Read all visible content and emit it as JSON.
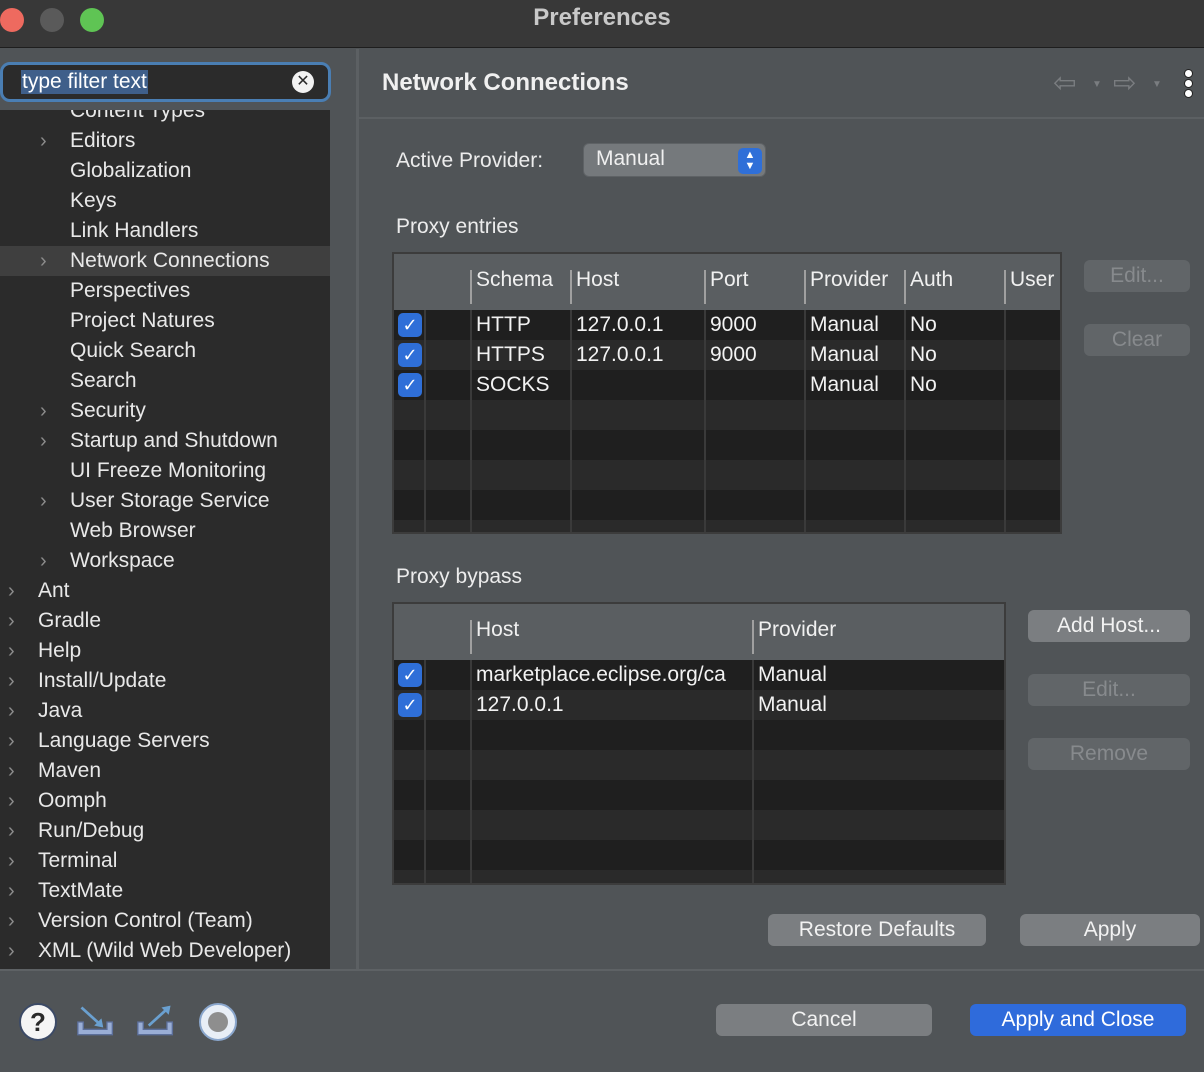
{
  "window": {
    "title": "Preferences"
  },
  "filter": {
    "value": "type filter text",
    "clear_icon": "clear-icon"
  },
  "tree": {
    "items": [
      {
        "label": "Content Types",
        "level": 1,
        "expandable": false,
        "selected": false
      },
      {
        "label": "Editors",
        "level": 1,
        "expandable": true,
        "selected": false
      },
      {
        "label": "Globalization",
        "level": 1,
        "expandable": false,
        "selected": false
      },
      {
        "label": "Keys",
        "level": 1,
        "expandable": false,
        "selected": false
      },
      {
        "label": "Link Handlers",
        "level": 1,
        "expandable": false,
        "selected": false
      },
      {
        "label": "Network Connections",
        "level": 1,
        "expandable": true,
        "selected": true
      },
      {
        "label": "Perspectives",
        "level": 1,
        "expandable": false,
        "selected": false
      },
      {
        "label": "Project Natures",
        "level": 1,
        "expandable": false,
        "selected": false
      },
      {
        "label": "Quick Search",
        "level": 1,
        "expandable": false,
        "selected": false
      },
      {
        "label": "Search",
        "level": 1,
        "expandable": false,
        "selected": false
      },
      {
        "label": "Security",
        "level": 1,
        "expandable": true,
        "selected": false
      },
      {
        "label": "Startup and Shutdown",
        "level": 1,
        "expandable": true,
        "selected": false
      },
      {
        "label": "UI Freeze Monitoring",
        "level": 1,
        "expandable": false,
        "selected": false
      },
      {
        "label": "User Storage Service",
        "level": 1,
        "expandable": true,
        "selected": false
      },
      {
        "label": "Web Browser",
        "level": 1,
        "expandable": false,
        "selected": false
      },
      {
        "label": "Workspace",
        "level": 1,
        "expandable": true,
        "selected": false
      },
      {
        "label": "Ant",
        "level": 0,
        "expandable": true,
        "selected": false
      },
      {
        "label": "Gradle",
        "level": 0,
        "expandable": true,
        "selected": false
      },
      {
        "label": "Help",
        "level": 0,
        "expandable": true,
        "selected": false
      },
      {
        "label": "Install/Update",
        "level": 0,
        "expandable": true,
        "selected": false
      },
      {
        "label": "Java",
        "level": 0,
        "expandable": true,
        "selected": false
      },
      {
        "label": "Language Servers",
        "level": 0,
        "expandable": true,
        "selected": false
      },
      {
        "label": "Maven",
        "level": 0,
        "expandable": true,
        "selected": false
      },
      {
        "label": "Oomph",
        "level": 0,
        "expandable": true,
        "selected": false
      },
      {
        "label": "Run/Debug",
        "level": 0,
        "expandable": true,
        "selected": false
      },
      {
        "label": "Terminal",
        "level": 0,
        "expandable": true,
        "selected": false
      },
      {
        "label": "TextMate",
        "level": 0,
        "expandable": true,
        "selected": false
      },
      {
        "label": "Version Control (Team)",
        "level": 0,
        "expandable": true,
        "selected": false
      },
      {
        "label": "XML (Wild Web Developer)",
        "level": 0,
        "expandable": true,
        "selected": false
      }
    ]
  },
  "page": {
    "title": "Network Connections",
    "back_icon": "back-arrow-icon",
    "forward_icon": "forward-arrow-icon",
    "menu_icon": "more-vertical-icon",
    "active_provider_label": "Active Provider:",
    "active_provider_value": "Manual",
    "proxy_entries": {
      "label": "Proxy entries",
      "columns": [
        "",
        "Schema",
        "Host",
        "Port",
        "Provider",
        "Auth",
        "User"
      ],
      "rows": [
        {
          "checked": true,
          "schema": "HTTP",
          "host": "127.0.0.1",
          "port": "9000",
          "provider": "Manual",
          "auth": "No",
          "user": ""
        },
        {
          "checked": true,
          "schema": "HTTPS",
          "host": "127.0.0.1",
          "port": "9000",
          "provider": "Manual",
          "auth": "No",
          "user": ""
        },
        {
          "checked": true,
          "schema": "SOCKS",
          "host": "",
          "port": "",
          "provider": "Manual",
          "auth": "No",
          "user": ""
        }
      ],
      "edit_label": "Edit...",
      "clear_label": "Clear"
    },
    "proxy_bypass": {
      "label": "Proxy bypass",
      "columns": [
        "",
        "Host",
        "Provider"
      ],
      "rows": [
        {
          "checked": true,
          "host": "marketplace.eclipse.org/ca",
          "provider": "Manual"
        },
        {
          "checked": true,
          "host": "127.0.0.1",
          "provider": "Manual"
        }
      ],
      "add_host_label": "Add Host...",
      "edit_label": "Edit...",
      "remove_label": "Remove"
    },
    "restore_defaults_label": "Restore Defaults",
    "apply_label": "Apply"
  },
  "footer": {
    "cancel_label": "Cancel",
    "apply_close_label": "Apply and Close",
    "icons": [
      "help-icon",
      "import-icon",
      "export-icon",
      "record-icon"
    ]
  },
  "colors": {
    "accent": "#2f6bdb",
    "filter_border": "#4a7eb3"
  }
}
